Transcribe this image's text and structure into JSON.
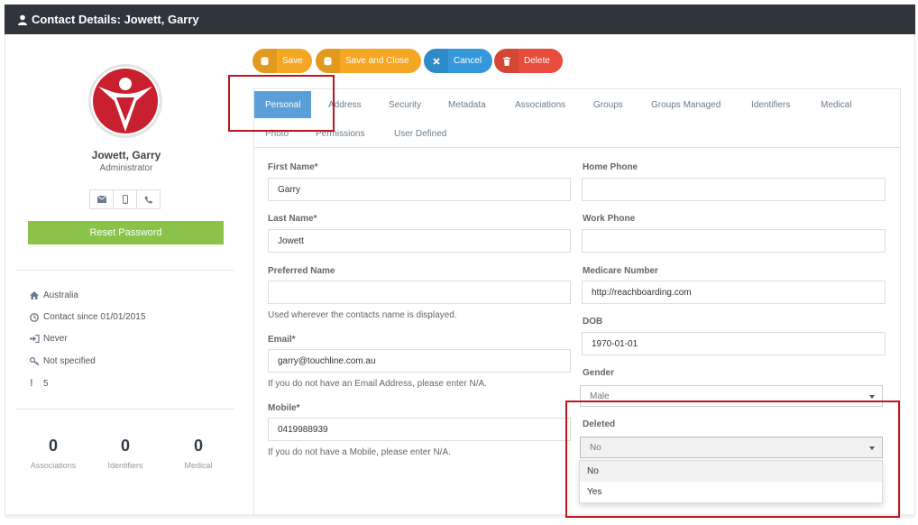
{
  "window": {
    "title": "Contact Details: Jowett, Garry"
  },
  "profile": {
    "name": "Jowett, Garry",
    "role": "Administrator",
    "reset_password": "Reset Password",
    "info": [
      {
        "icon": "home-icon",
        "text": "Australia"
      },
      {
        "icon": "clock-icon",
        "text": "Contact since 01/01/2015"
      },
      {
        "icon": "sign-in-icon",
        "text": "Never"
      },
      {
        "icon": "key-icon",
        "text": "Not specified"
      },
      {
        "icon": "exclamation-icon",
        "text": "5"
      }
    ],
    "stats": [
      {
        "value": "0",
        "label": "Associations"
      },
      {
        "value": "0",
        "label": "Identifiers"
      },
      {
        "value": "0",
        "label": "Medical"
      }
    ]
  },
  "actions": {
    "save": "Save",
    "save_close": "Save and Close",
    "cancel": "Cancel",
    "delete": "Delete"
  },
  "tabs": [
    "Personal",
    "Address",
    "Security",
    "Metadata",
    "Associations",
    "Groups",
    "Groups Managed",
    "Identifiers",
    "Medical",
    "Photo",
    "Permissions",
    "User Defined"
  ],
  "form": {
    "first_name": {
      "label": "First Name*",
      "value": "Garry"
    },
    "last_name": {
      "label": "Last Name*",
      "value": "Jowett"
    },
    "preferred_name": {
      "label": "Preferred Name",
      "value": "",
      "help": "Used wherever the contacts name is displayed."
    },
    "email": {
      "label": "Email*",
      "value": "garry@touchline.com.au",
      "help": "If you do not have an Email Address, please enter N/A."
    },
    "mobile": {
      "label": "Mobile*",
      "value": "0419988939",
      "help": "If you do not have a Mobile, please enter N/A."
    },
    "home_phone": {
      "label": "Home Phone",
      "value": ""
    },
    "work_phone": {
      "label": "Work Phone",
      "value": ""
    },
    "medicare": {
      "label": "Medicare Number",
      "value": "http://reachboarding.com"
    },
    "dob": {
      "label": "DOB",
      "value": "1970-01-01"
    },
    "gender": {
      "label": "Gender",
      "value": "Male"
    },
    "deleted": {
      "label": "Deleted",
      "value": "No",
      "options": [
        "No",
        "Yes"
      ]
    }
  },
  "colors": {
    "titlebar": "#2f353b",
    "save": "#f5a623",
    "cancel": "#3498db",
    "delete": "#e74c3c",
    "reset": "#8bc34a",
    "active_tab": "#5a9fd8",
    "highlight": "#c0141e"
  }
}
